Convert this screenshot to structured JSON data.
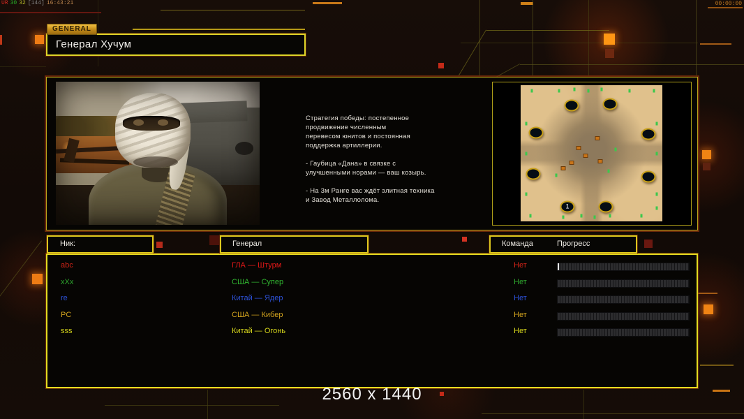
{
  "debug_overlay": {
    "parts": [
      {
        "text": "UR",
        "color": "#d02820"
      },
      {
        "text": "30",
        "color": "#28b428"
      },
      {
        "text": "32",
        "color": "#b4b428"
      },
      {
        "text": "[144]",
        "color": "#808080"
      },
      {
        "text": "16:43:21",
        "color": "#c08850"
      }
    ]
  },
  "clock": "00:00:00",
  "header": {
    "tab": "GENERAL",
    "title": "Генерал Хучум"
  },
  "bio": {
    "lines": [
      "Стратегия победы: постепенное",
      "продвижение численным",
      "перевесом юнитов и постоянная",
      "поддержка артиллерии.",
      "",
      "- Гаубица «Дана» в связке с",
      "улучшенными норами — ваш козырь.",
      "",
      "- На 3м Ранге вас ждёт элитная техника",
      "и Завод Металлолома."
    ]
  },
  "map": {
    "start_position_label": "1"
  },
  "players": {
    "headers": {
      "nick": "Ник:",
      "general": "Генерал",
      "team": "Команда",
      "progress": "Прогресс"
    },
    "rows": [
      {
        "nick": "abc",
        "general": "ГЛА — Штурм",
        "team": "Нет",
        "color": "#d22418",
        "general_color": "#e01818",
        "progress_tick": true
      },
      {
        "nick": "xXx",
        "general": "США — Супер",
        "team": "Нет",
        "color": "#2ea62e",
        "general_color": "#30b430",
        "progress_tick": false
      },
      {
        "nick": "re",
        "general": "Китай — Ядер",
        "team": "Нет",
        "color": "#2d52d8",
        "general_color": "#2d52d8",
        "progress_tick": false
      },
      {
        "nick": "PC",
        "general": "США — Кибер",
        "team": "Нет",
        "color": "#d2a31e",
        "general_color": "#d2a31e",
        "progress_tick": false
      },
      {
        "nick": "sss",
        "general": "Китай — Огонь",
        "team": "Нет",
        "color": "#d6d61c",
        "general_color": "#d6d61c",
        "progress_tick": false
      }
    ]
  },
  "footer": {
    "resolution_label": "2560 x 1440"
  },
  "accent_colors": {
    "panel_border": "#e4dc20",
    "badge": "#e8a81c",
    "circuit_line": "#56501a",
    "glow_square": "#f08414"
  }
}
